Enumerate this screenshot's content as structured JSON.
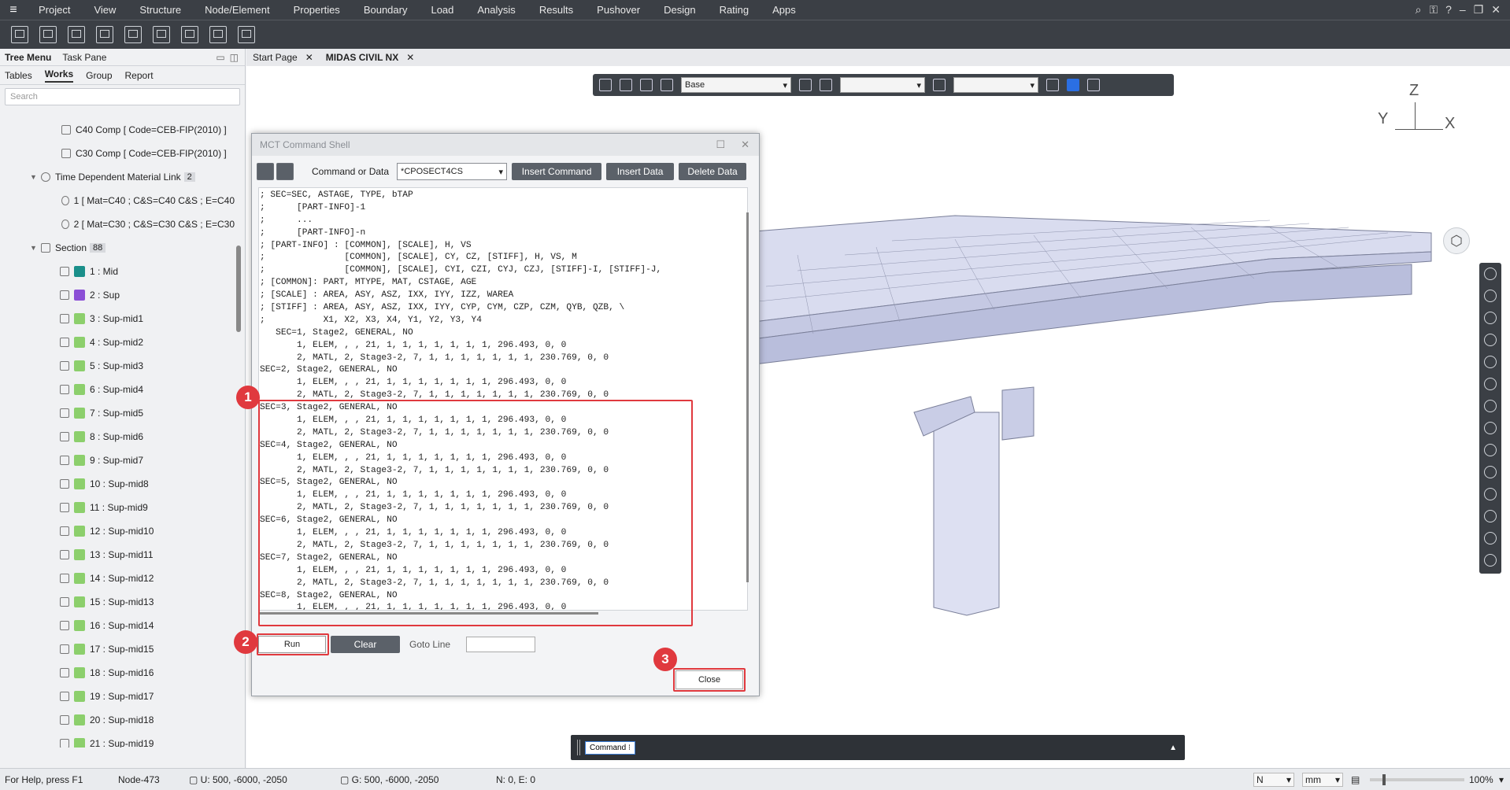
{
  "menubar": {
    "items": [
      "Project",
      "View",
      "Structure",
      "Node/Element",
      "Properties",
      "Boundary",
      "Load",
      "Analysis",
      "Results",
      "Pushover",
      "Design",
      "Rating",
      "Apps"
    ]
  },
  "left_panel": {
    "tabs": [
      "Tree Menu",
      "Task Pane"
    ],
    "subtabs": [
      "Tables",
      "Works",
      "Group",
      "Report"
    ],
    "search_placeholder": "Search",
    "tree": [
      {
        "label": "C40 Comp [ Code=CEB-FIP(2010) ]"
      },
      {
        "label": "C30 Comp [ Code=CEB-FIP(2010) ]"
      },
      {
        "label": "Time Dependent Material Link",
        "badge": "2"
      },
      {
        "label": "1 [ Mat=C40 ; C&S=C40 C&S ; E=C40"
      },
      {
        "label": "2 [ Mat=C30 ; C&S=C30 C&S ; E=C30"
      },
      {
        "label": "Section",
        "badge": "88"
      }
    ],
    "sections": [
      {
        "label": "1 : Mid",
        "color": "#1a8f8a"
      },
      {
        "label": "2 : Sup",
        "color": "#8b4fd6"
      },
      {
        "label": "3 : Sup-mid1",
        "color": "#8ccf6c"
      },
      {
        "label": "4 : Sup-mid2",
        "color": "#8ccf6c"
      },
      {
        "label": "5 : Sup-mid3",
        "color": "#8ccf6c"
      },
      {
        "label": "6 : Sup-mid4",
        "color": "#8ccf6c"
      },
      {
        "label": "7 : Sup-mid5",
        "color": "#8ccf6c"
      },
      {
        "label": "8 : Sup-mid6",
        "color": "#8ccf6c"
      },
      {
        "label": "9 : Sup-mid7",
        "color": "#8ccf6c"
      },
      {
        "label": "10 : Sup-mid8",
        "color": "#8ccf6c"
      },
      {
        "label": "11 : Sup-mid9",
        "color": "#8ccf6c"
      },
      {
        "label": "12 : Sup-mid10",
        "color": "#8ccf6c"
      },
      {
        "label": "13 : Sup-mid11",
        "color": "#8ccf6c"
      },
      {
        "label": "14 : Sup-mid12",
        "color": "#8ccf6c"
      },
      {
        "label": "15 : Sup-mid13",
        "color": "#8ccf6c"
      },
      {
        "label": "16 : Sup-mid14",
        "color": "#8ccf6c"
      },
      {
        "label": "17 : Sup-mid15",
        "color": "#8ccf6c"
      },
      {
        "label": "18 : Sup-mid16",
        "color": "#8ccf6c"
      },
      {
        "label": "19 : Sup-mid17",
        "color": "#8ccf6c"
      },
      {
        "label": "20 : Sup-mid18",
        "color": "#8ccf6c"
      },
      {
        "label": "21 : Sup-mid19",
        "color": "#8ccf6c"
      }
    ]
  },
  "doc_tabs": [
    "Start Page",
    "MIDAS CIVIL NX"
  ],
  "view_toolbar": {
    "combo1": "Base",
    "combo2": "",
    "combo3": ""
  },
  "axes": {
    "z": "Z",
    "y": "Y",
    "x": "X"
  },
  "dialog": {
    "title": "MCT Command Shell",
    "cmd_label": "Command or Data",
    "cmd_value": "*CPOSECT4CS",
    "insert_command": "Insert Command",
    "insert_data": "Insert Data",
    "delete_data": "Delete Data",
    "code_lines": [
      "; SEC=SEC, ASTAGE, TYPE, bTAP",
      ";      [PART-INFO]-1",
      ";      ...",
      ";      [PART-INFO]-n",
      "; [PART-INFO] : [COMMON], [SCALE], H, VS",
      ";               [COMMON], [SCALE], CY, CZ, [STIFF], H, VS, M",
      ";               [COMMON], [SCALE], CYI, CZI, CYJ, CZJ, [STIFF]-I, [STIFF]-J,",
      "; [COMMON]: PART, MTYPE, MAT, CSTAGE, AGE",
      "; [SCALE] : AREA, ASY, ASZ, IXX, IYY, IZZ, WAREA",
      "; [STIFF] : AREA, ASY, ASZ, IXX, IYY, CYP, CYM, CZP, CZM, QYB, QZB, \\",
      ";           X1, X2, X3, X4, Y1, Y2, Y3, Y4",
      "   SEC=1, Stage2, GENERAL, NO",
      "       1, ELEM, , , 21, 1, 1, 1, 1, 1, 1, 1, 296.493, 0, 0",
      "       2, MATL, 2, Stage3-2, 7, 1, 1, 1, 1, 1, 1, 1, 230.769, 0, 0",
      "SEC=2, Stage2, GENERAL, NO",
      "       1, ELEM, , , 21, 1, 1, 1, 1, 1, 1, 1, 296.493, 0, 0",
      "       2, MATL, 2, Stage3-2, 7, 1, 1, 1, 1, 1, 1, 1, 230.769, 0, 0",
      "SEC=3, Stage2, GENERAL, NO",
      "       1, ELEM, , , 21, 1, 1, 1, 1, 1, 1, 1, 296.493, 0, 0",
      "       2, MATL, 2, Stage3-2, 7, 1, 1, 1, 1, 1, 1, 1, 230.769, 0, 0",
      "SEC=4, Stage2, GENERAL, NO",
      "       1, ELEM, , , 21, 1, 1, 1, 1, 1, 1, 1, 296.493, 0, 0",
      "       2, MATL, 2, Stage3-2, 7, 1, 1, 1, 1, 1, 1, 1, 230.769, 0, 0",
      "SEC=5, Stage2, GENERAL, NO",
      "       1, ELEM, , , 21, 1, 1, 1, 1, 1, 1, 1, 296.493, 0, 0",
      "       2, MATL, 2, Stage3-2, 7, 1, 1, 1, 1, 1, 1, 1, 230.769, 0, 0",
      "SEC=6, Stage2, GENERAL, NO",
      "       1, ELEM, , , 21, 1, 1, 1, 1, 1, 1, 1, 296.493, 0, 0",
      "       2, MATL, 2, Stage3-2, 7, 1, 1, 1, 1, 1, 1, 1, 230.769, 0, 0",
      "SEC=7, Stage2, GENERAL, NO",
      "       1, ELEM, , , 21, 1, 1, 1, 1, 1, 1, 1, 296.493, 0, 0",
      "       2, MATL, 2, Stage3-2, 7, 1, 1, 1, 1, 1, 1, 1, 230.769, 0, 0",
      "SEC=8, Stage2, GENERAL, NO",
      "       1, ELEM, , , 21, 1, 1, 1, 1, 1, 1, 1, 296.493, 0, 0"
    ],
    "run": "Run",
    "clear": "Clear",
    "goto_line": "Goto Line",
    "close": "Close"
  },
  "annotations": [
    "1",
    "2",
    "3"
  ],
  "command_bar": {
    "label": "Command"
  },
  "status": {
    "help": "For Help, press F1",
    "node": "Node-473",
    "u": "U: 500, -6000, -2050",
    "g": "G: 500, -6000, -2050",
    "ne": "N: 0, E: 0",
    "force_unit": "N",
    "length_unit": "mm",
    "zoom": "100%"
  },
  "colors": {
    "accent_red": "#e0393e",
    "dark_bar": "#3b3f45"
  }
}
